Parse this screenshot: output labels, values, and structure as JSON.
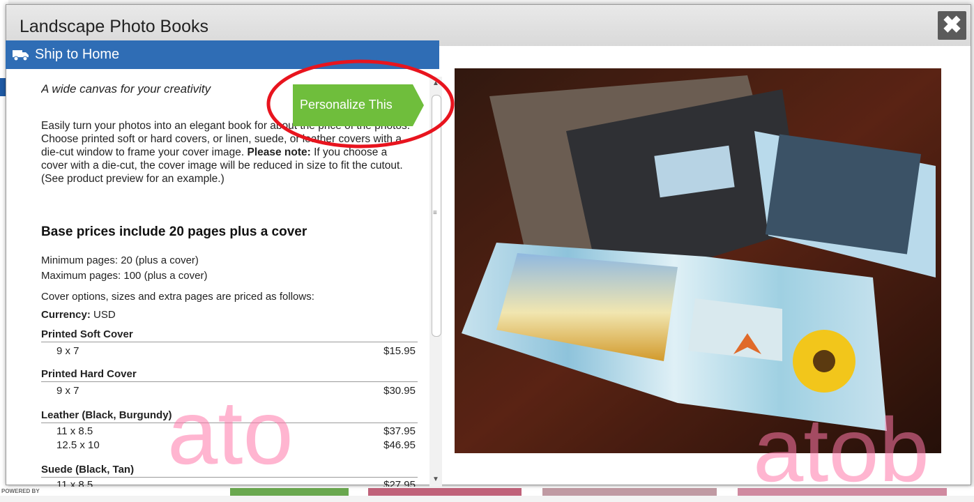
{
  "modal": {
    "title": "Landscape Photo Books",
    "close_label": "✖"
  },
  "ship_bar": {
    "icon": "truck-icon",
    "label": "Ship to Home"
  },
  "content": {
    "tagline": "A wide canvas for your creativity",
    "description_p1": "Easily turn your photos into an elegant book for about the price of the photos. Choose printed soft or hard covers, or linen, suede, or leather covers with a die-cut window to frame your cover image.",
    "description_note_label": "Please note:",
    "description_p2": " If you choose a cover with a die-cut, the cover image will be reduced in size to fit the cutout. (See product preview for an example.)",
    "personalize_button": "Personalize This",
    "price_heading": "Base prices include 20 pages plus a cover",
    "min_pages": "Minimum pages: 20 (plus a cover)",
    "max_pages": "Maximum pages: 100 (plus a cover)",
    "pricing_note": "Cover options, sizes and extra pages are priced as follows:",
    "currency_label": "Currency:",
    "currency_value": "USD",
    "groups": [
      {
        "title": "Printed Soft Cover",
        "rows": [
          {
            "size": "9 x 7",
            "price": "$15.95"
          }
        ]
      },
      {
        "title": "Printed Hard Cover",
        "rows": [
          {
            "size": "9 x 7",
            "price": "$30.95"
          }
        ]
      },
      {
        "title": "Leather (Black, Burgundy)",
        "rows": [
          {
            "size": "11 x 8.5",
            "price": "$37.95"
          },
          {
            "size": "12.5 x 10",
            "price": "$46.95"
          }
        ]
      },
      {
        "title": "Suede (Black, Tan)",
        "rows": [
          {
            "size": "11 x 8.5",
            "price": "$27.95"
          }
        ]
      }
    ]
  },
  "background": {
    "powered_by": "POWERED BY"
  },
  "colors": {
    "ship_bar": "#2f6db5",
    "personalize": "#6fbe3c",
    "annotation": "#e8141e",
    "watermark": "#ff78aa"
  }
}
